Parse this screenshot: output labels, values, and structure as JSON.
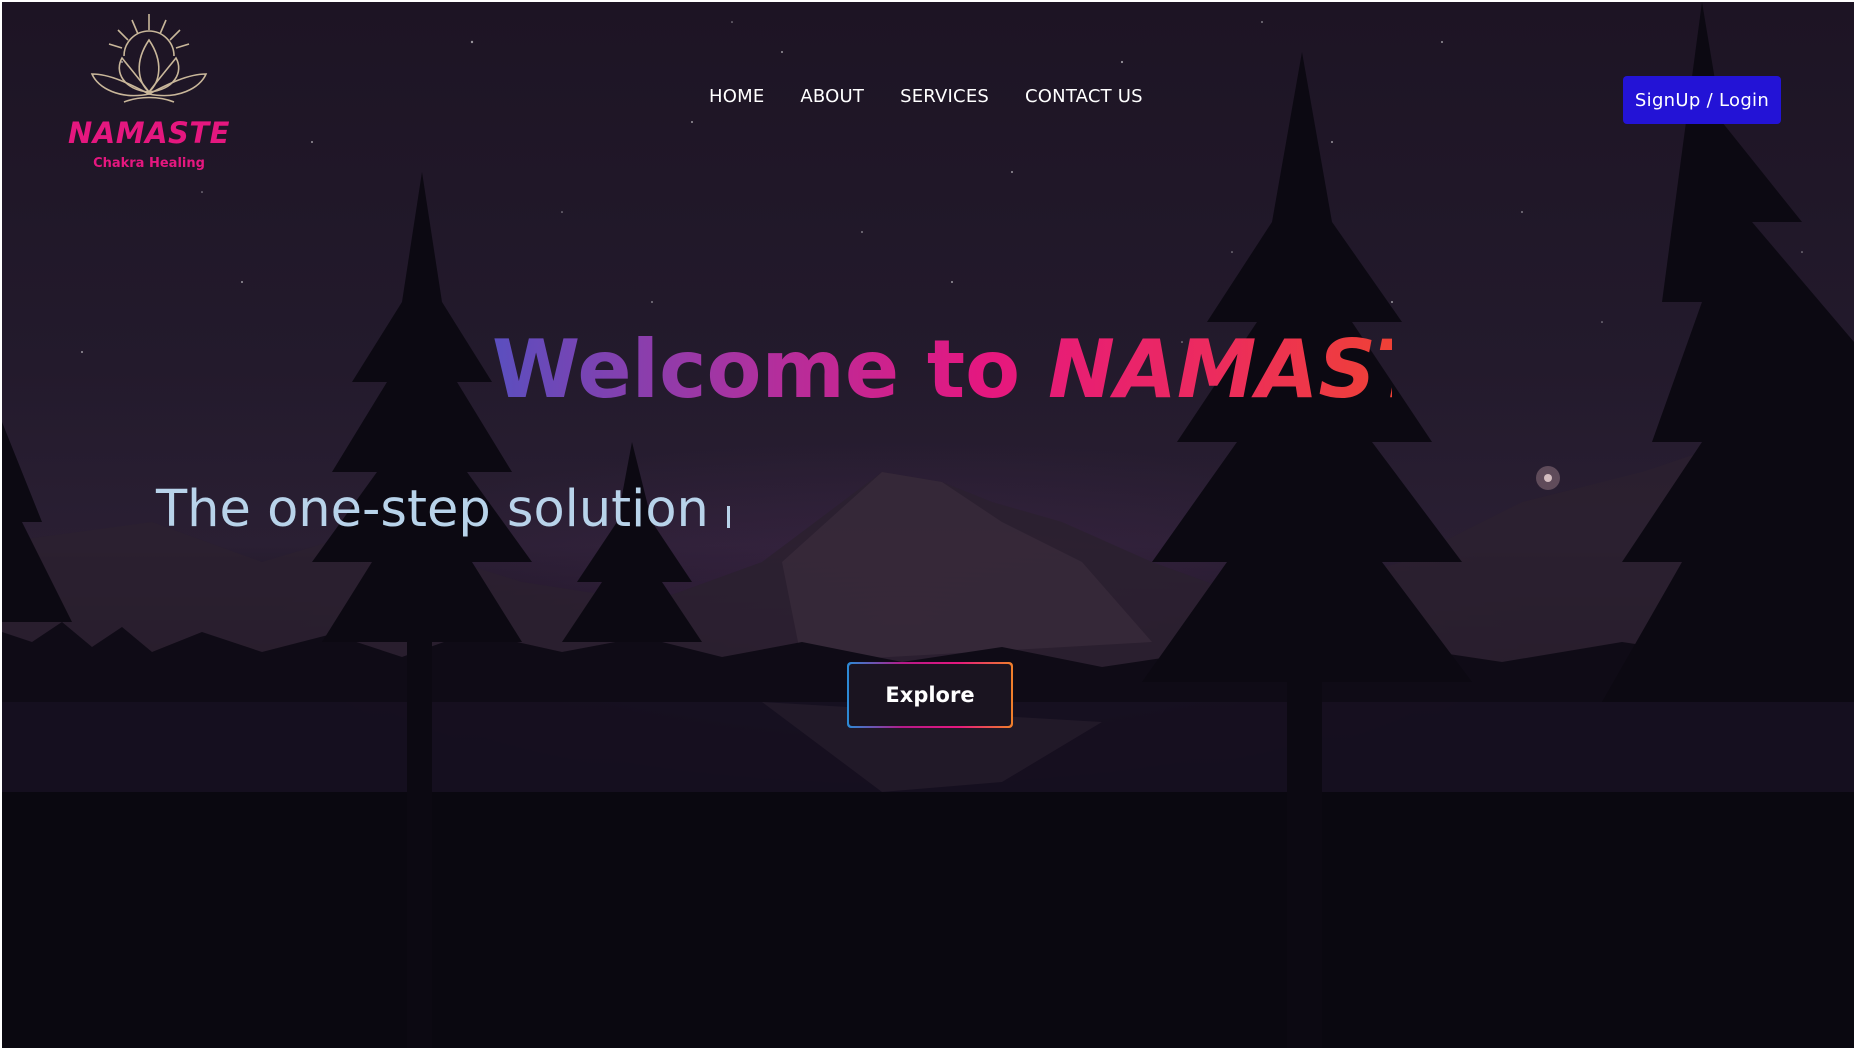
{
  "brand": {
    "name": "NAMASTE",
    "subtitle": "Chakra Healing",
    "logo_icon": "lotus-sun-icon"
  },
  "nav": {
    "items": [
      {
        "label": "HOME"
      },
      {
        "label": "ABOUT"
      },
      {
        "label": "SERVICES"
      },
      {
        "label": "CONTACT US"
      }
    ]
  },
  "auth": {
    "signup_label": "SignUp / Login"
  },
  "hero": {
    "welcome_prefix": "Welcome to",
    "welcome_brand": "NAMASTE",
    "tagline": "The one-step solution",
    "explore_label": "Explore"
  },
  "colors": {
    "accent_pink": "#e5177f",
    "signup_blue": "#2313d6",
    "tagline_blue": "#b8d3ea"
  }
}
